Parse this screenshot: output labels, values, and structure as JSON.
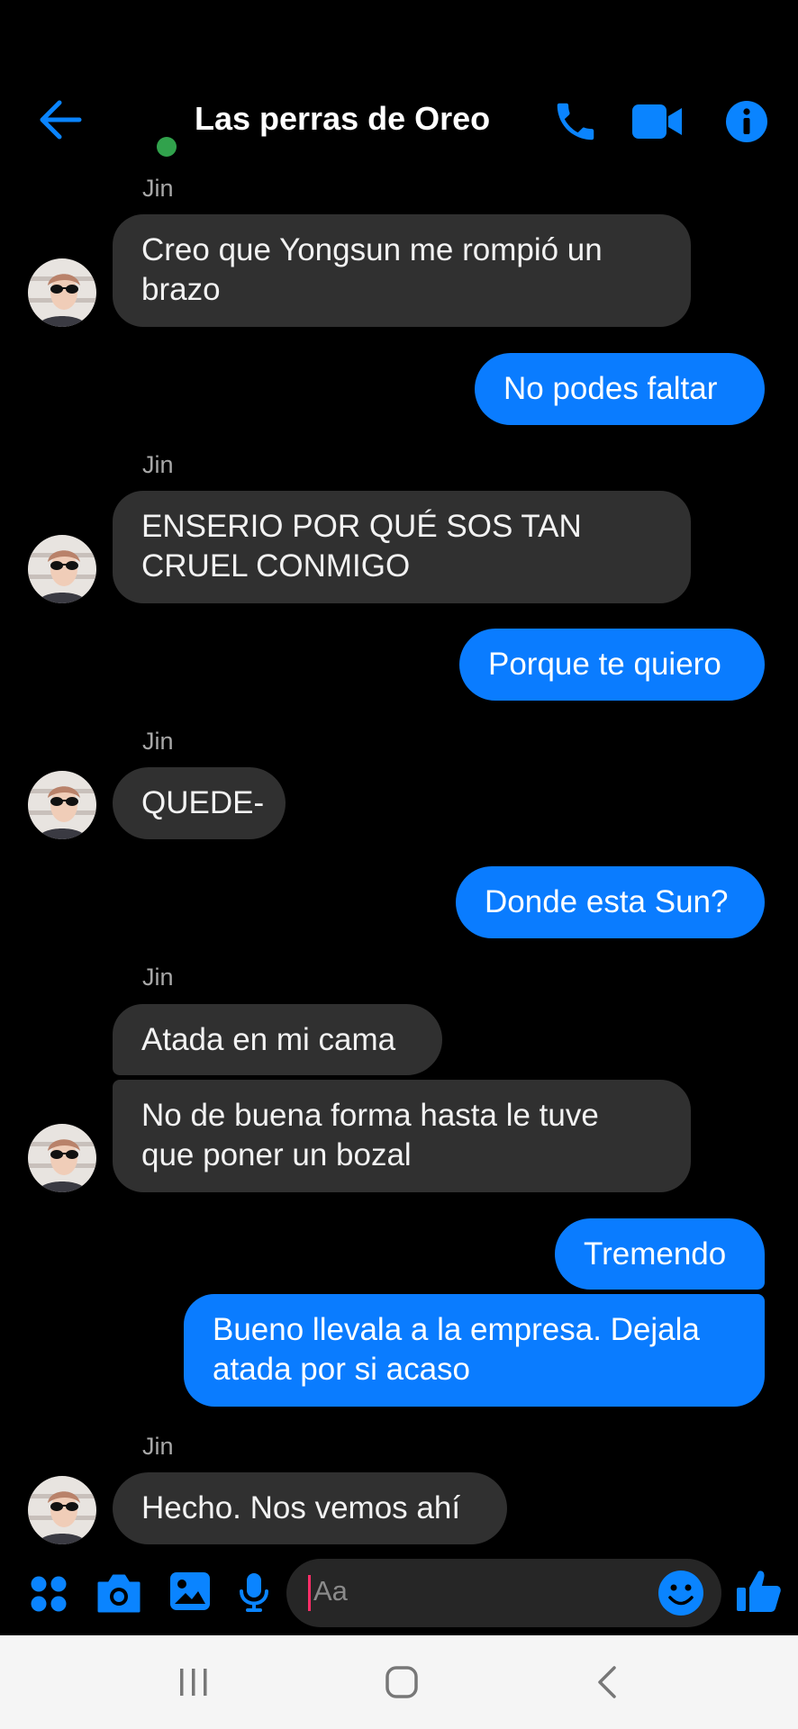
{
  "header": {
    "title": "Las perras de Oreo",
    "icons": {
      "back": "back-arrow-icon",
      "call": "phone-icon",
      "video": "video-camera-icon",
      "info": "info-icon"
    },
    "online_status_color": "#31a24c",
    "accent": "#0a84ff"
  },
  "messages": [
    {
      "sender": "Jin",
      "lines": [
        "Creo que Yongsun me rompió un",
        "brazo"
      ],
      "direction": "incoming"
    },
    {
      "lines": [
        "No podes faltar"
      ],
      "direction": "outgoing"
    },
    {
      "sender": "Jin",
      "lines": [
        "ENSERIO POR QUÉ SOS TAN",
        "CRUEL CONMIGO"
      ],
      "direction": "incoming"
    },
    {
      "lines": [
        "Porque te quiero"
      ],
      "direction": "outgoing"
    },
    {
      "sender": "Jin",
      "lines": [
        "QUEDE-"
      ],
      "direction": "incoming"
    },
    {
      "lines": [
        "Donde esta Sun?"
      ],
      "direction": "outgoing"
    },
    {
      "sender": "Jin",
      "lines": [
        "Atada en mi cama"
      ],
      "direction": "incoming"
    },
    {
      "lines": [
        "No de buena forma hasta le tuve",
        "que poner un bozal"
      ],
      "direction": "incoming"
    },
    {
      "lines": [
        "Tremendo"
      ],
      "direction": "outgoing"
    },
    {
      "lines": [
        "Bueno llevala a la empresa. Dejala",
        "atada por si acaso"
      ],
      "direction": "outgoing"
    },
    {
      "sender": "Jin",
      "lines": [
        "Hecho. Nos vemos ahí"
      ],
      "direction": "incoming"
    }
  ],
  "composer": {
    "placeholder": "Aa",
    "icons": [
      "apps-menu-icon",
      "camera-icon",
      "gallery-icon",
      "microphone-icon",
      "emoji-icon",
      "like-thumbs-up-icon"
    ]
  },
  "colors": {
    "outgoing_bubble": "#0a7cff",
    "incoming_bubble": "#303030",
    "background": "#000000"
  },
  "navbar": {
    "icons": [
      "recent-apps-icon",
      "home-icon",
      "back-nav-icon"
    ]
  }
}
